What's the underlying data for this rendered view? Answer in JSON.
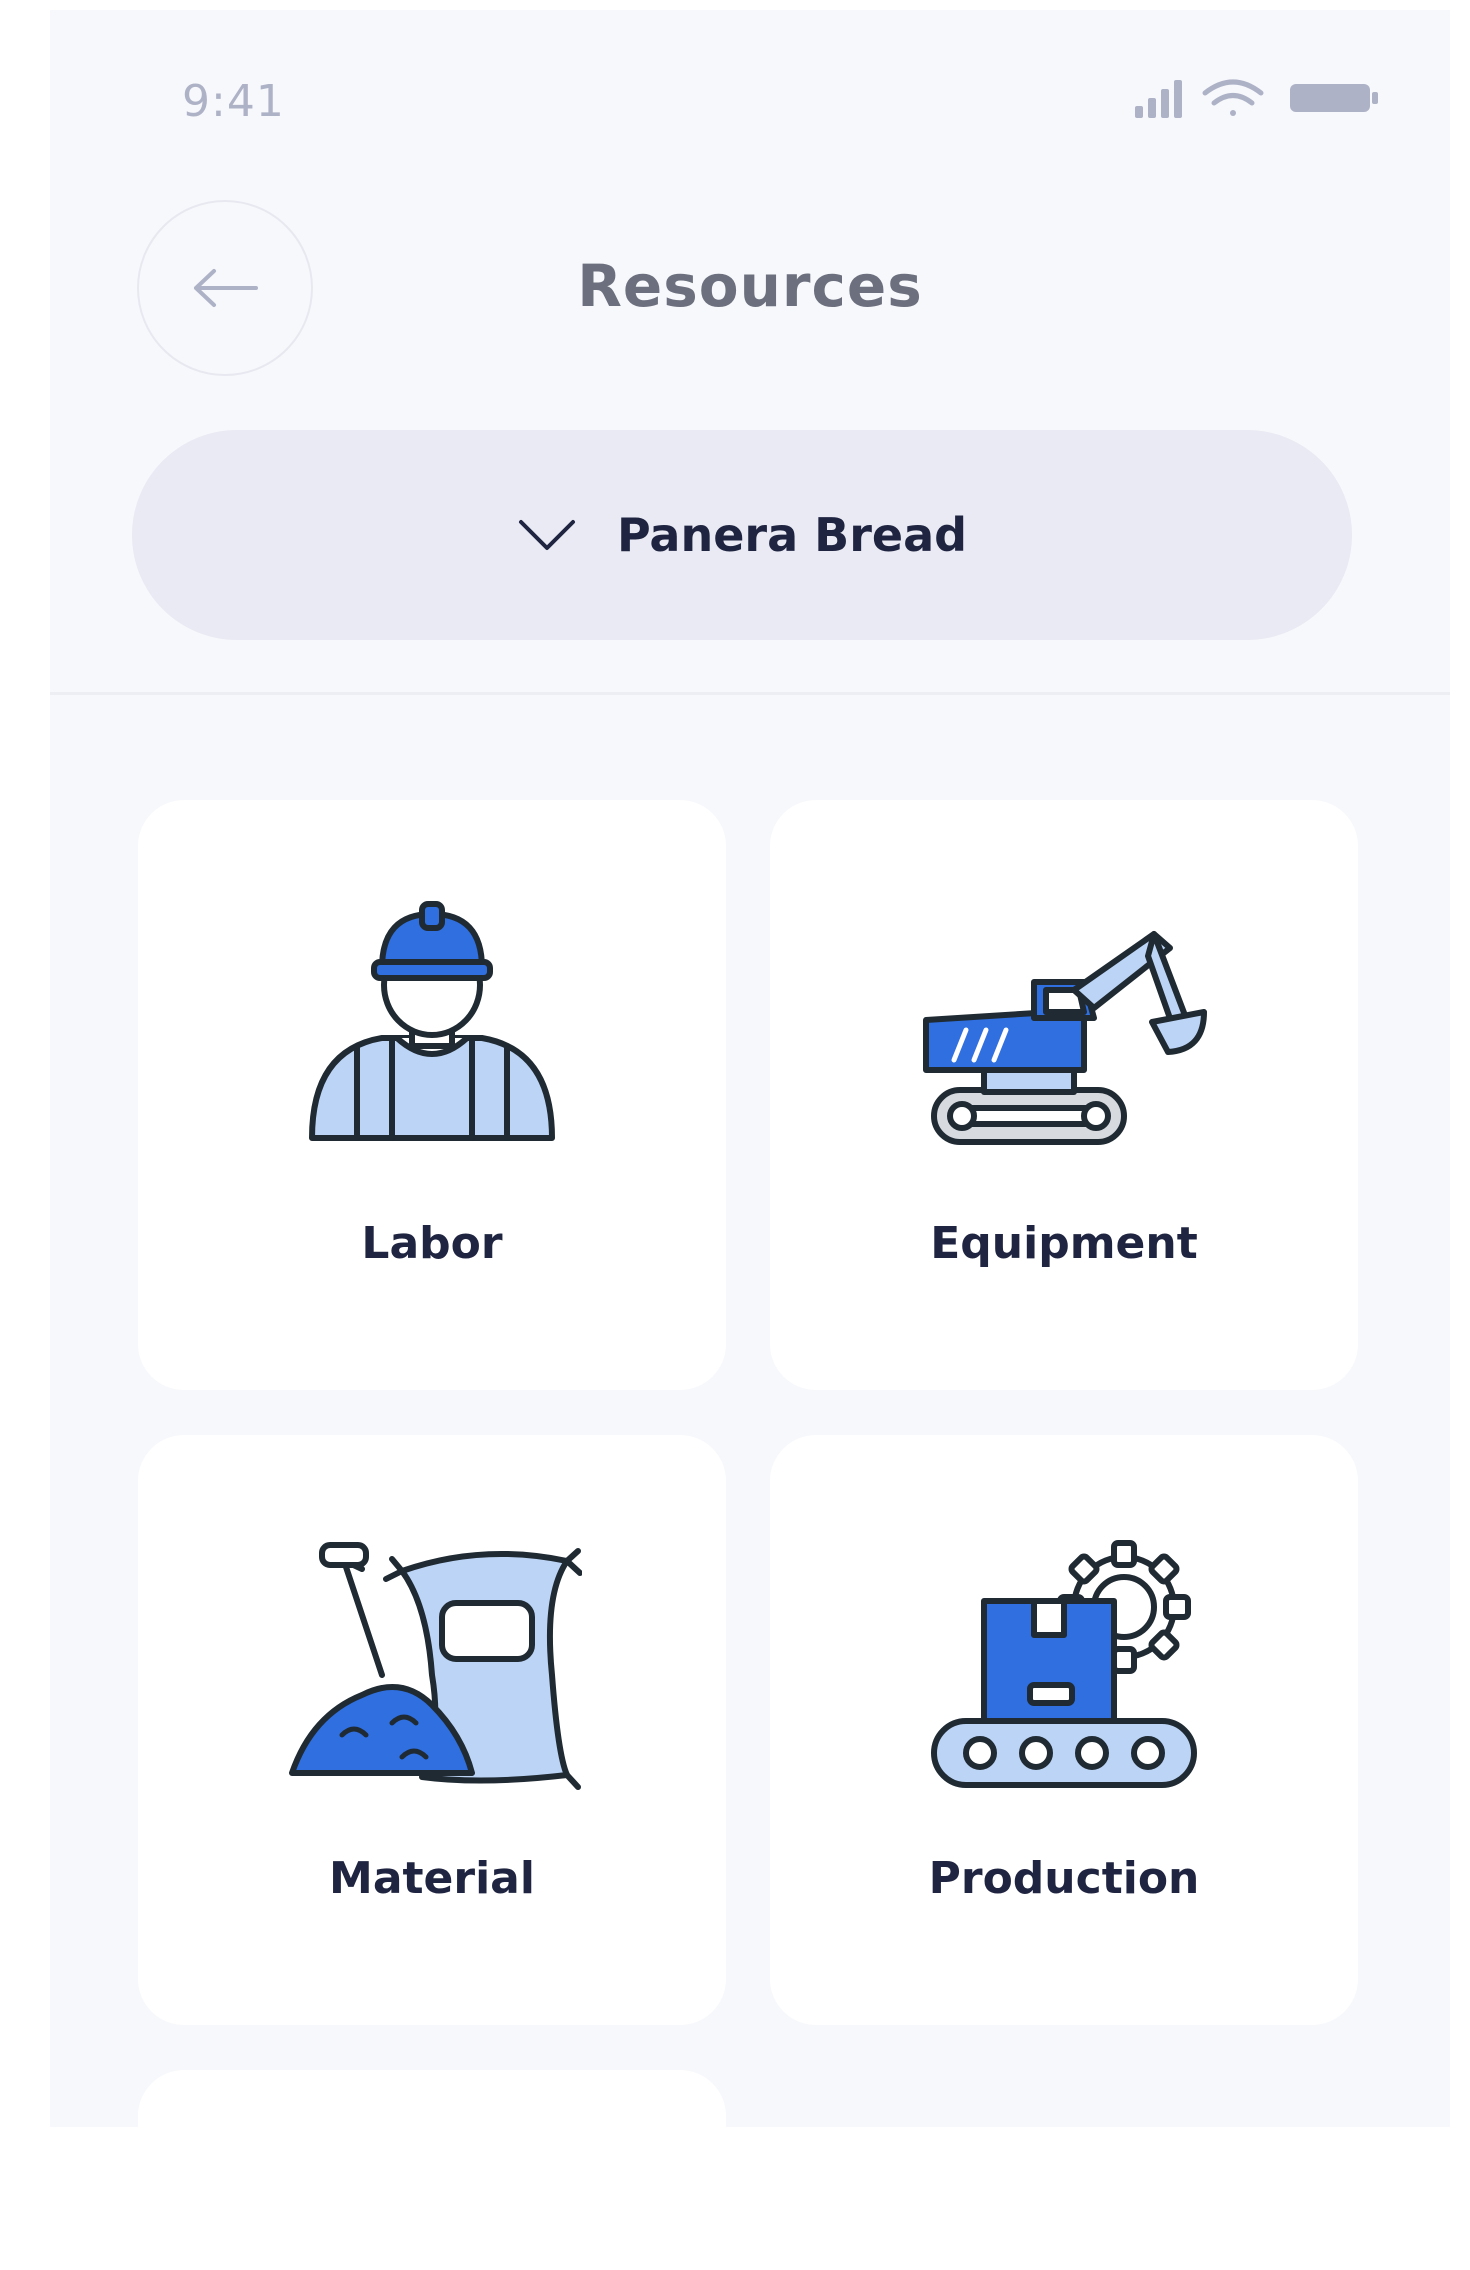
{
  "status_bar": {
    "time": "9:41",
    "icons": [
      "signal-icon",
      "wifi-icon",
      "battery-icon"
    ]
  },
  "header": {
    "title": "Resources",
    "back_icon": "arrow-left-icon"
  },
  "project_selector": {
    "selected": "Panera Bread",
    "icon": "chevron-down-icon"
  },
  "resources": [
    {
      "label": "Labor",
      "icon": "worker-icon"
    },
    {
      "label": "Equipment",
      "icon": "excavator-icon"
    },
    {
      "label": "Material",
      "icon": "material-bag-shovel-icon"
    },
    {
      "label": "Production",
      "icon": "conveyor-gear-icon"
    }
  ],
  "colors": {
    "accent": "#2f6fe0",
    "accent_light": "#bcd4f6",
    "outline": "#1f2a33",
    "background": "#f7f8fc",
    "card": "#ffffff",
    "selector": "#e9eaf3"
  }
}
